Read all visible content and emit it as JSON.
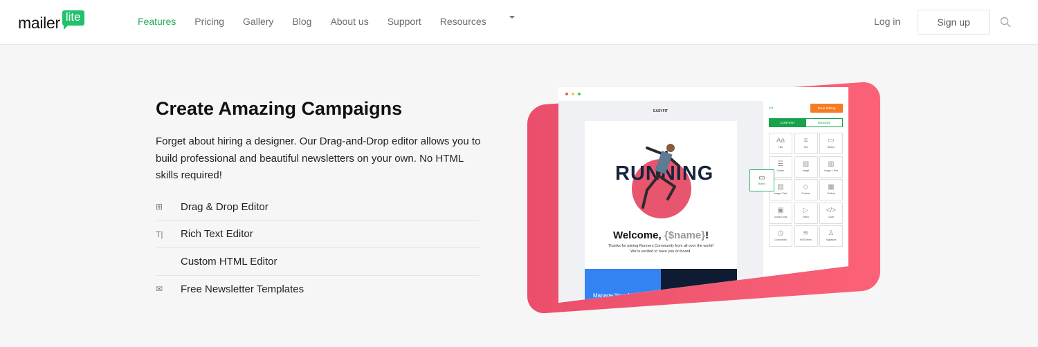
{
  "header": {
    "logo": {
      "main": "mailer",
      "badge": "lite"
    },
    "nav": [
      {
        "label": "Features",
        "active": true
      },
      {
        "label": "Pricing"
      },
      {
        "label": "Gallery"
      },
      {
        "label": "Blog"
      },
      {
        "label": "About us"
      },
      {
        "label": "Support"
      },
      {
        "label": "Resources",
        "dropdown": true
      }
    ],
    "login": "Log in",
    "signup": "Sign up",
    "search_icon": "search-icon",
    "accent": "#21c16b"
  },
  "hero": {
    "title": "Create Amazing Campaigns",
    "description": "Forget about hiring a designer. Our Drag-and-Drop editor allows you to build professional and beautiful newsletters on your own. No HTML skills required!",
    "features": [
      {
        "icon": "drag-drop-icon",
        "label": "Drag & Drop Editor"
      },
      {
        "icon": "text-icon",
        "label": "Rich Text Editor"
      },
      {
        "icon": "code-icon",
        "label": "Custom HTML Editor"
      },
      {
        "icon": "template-icon",
        "label": "Free Newsletter Templates"
      }
    ]
  },
  "mockup": {
    "brand": "EASYFIT",
    "headline": "RUNNING",
    "welcome": "Welcome, ",
    "name_tag": "{$name}",
    "exclaim": "!",
    "thanks": "Thanks for joining Runners Community from all over the world! We're excited to have you on board.",
    "manage": "Manage Your Account",
    "done": "Done Editing",
    "tabs": [
      "CONTENT",
      "DESIGN"
    ],
    "tiles": [
      {
        "g": "Aa",
        "l": "Title"
      },
      {
        "g": "≡",
        "l": "Text"
      },
      {
        "g": "▭",
        "l": "Button"
      },
      {
        "g": "☰",
        "l": "Divider"
      },
      {
        "g": "▨",
        "l": "Image"
      },
      {
        "g": "▥",
        "l": "Image + Text"
      },
      {
        "g": "▧",
        "l": "Image / Text"
      },
      {
        "g": "◇",
        "l": "Product"
      },
      {
        "g": "▦",
        "l": "Gallery"
      },
      {
        "g": "▣",
        "l": "Social Links"
      },
      {
        "g": "▷",
        "l": "Video"
      },
      {
        "g": "</>",
        "l": "Code"
      },
      {
        "g": "◷",
        "l": "Countdown"
      },
      {
        "g": "≋",
        "l": "RSS Items"
      },
      {
        "g": "♙",
        "l": "Signature"
      }
    ],
    "drag_label": "Button"
  }
}
